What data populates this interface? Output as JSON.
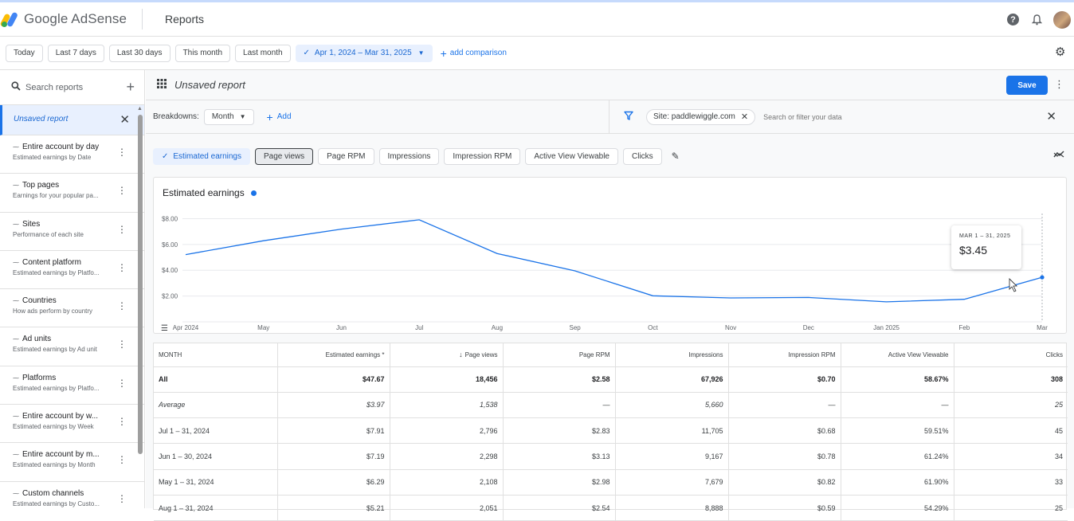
{
  "header": {
    "app_name": "Google AdSense",
    "page_title": "Reports",
    "help_glyph": "?",
    "bell_glyph": "🔔"
  },
  "date_filters": {
    "chips": [
      "Today",
      "Last 7 days",
      "Last 30 days",
      "This month",
      "Last month"
    ],
    "selected_range": "Apr 1, 2024 – Mar 31, 2025",
    "add_comparison": "add comparison"
  },
  "sidebar": {
    "search_placeholder": "Search reports",
    "selected": "Unsaved report",
    "items": [
      {
        "title": "Entire account by day",
        "sub": "Estimated earnings by Date"
      },
      {
        "title": "Top pages",
        "sub": "Earnings for your popular pa..."
      },
      {
        "title": "Sites",
        "sub": "Performance of each site"
      },
      {
        "title": "Content platform",
        "sub": "Estimated earnings by Platfo..."
      },
      {
        "title": "Countries",
        "sub": "How ads perform by country"
      },
      {
        "title": "Ad units",
        "sub": "Estimated earnings by Ad unit"
      },
      {
        "title": "Platforms",
        "sub": "Estimated earnings by Platfo..."
      },
      {
        "title": "Entire account by w...",
        "sub": "Estimated earnings by Week"
      },
      {
        "title": "Entire account by m...",
        "sub": "Estimated earnings by Month"
      },
      {
        "title": "Custom channels",
        "sub": "Estimated earnings by Custo..."
      }
    ]
  },
  "report": {
    "name": "Unsaved report",
    "save_label": "Save",
    "breakdowns_label": "Breakdowns:",
    "breakdown_value": "Month",
    "add_label": "Add",
    "site_filter": "Site: paddlewiggle.com",
    "filter_placeholder": "Search or filter your data"
  },
  "metrics": [
    "Estimated earnings",
    "Page views",
    "Page RPM",
    "Impressions",
    "Impression RPM",
    "Active View Viewable",
    "Clicks"
  ],
  "chart_data": {
    "type": "line",
    "title": "Estimated earnings",
    "x": [
      "Apr 2024",
      "May",
      "Jun",
      "Jul",
      "Aug",
      "Sep",
      "Oct",
      "Nov",
      "Dec",
      "Jan 2025",
      "Feb",
      "Mar"
    ],
    "values": [
      5.21,
      6.29,
      7.19,
      7.91,
      5.3,
      3.95,
      2.02,
      1.85,
      1.89,
      1.55,
      1.75,
      3.45
    ],
    "y_ticks": [
      2,
      4,
      6,
      8
    ],
    "y_tick_labels": [
      "$2.00",
      "$4.00",
      "$6.00",
      "$8.00"
    ],
    "ylim": [
      0,
      8.4
    ],
    "grid": true,
    "color": "#1a73e8",
    "tooltip": {
      "date": "MAR 1 – 31, 2025",
      "value": "$3.45"
    }
  },
  "table": {
    "headers": [
      "MONTH",
      "Estimated earnings *",
      "Page views",
      "Page RPM",
      "Impressions",
      "Impression RPM",
      "Active View Viewable",
      "Clicks"
    ],
    "total": [
      "All",
      "$47.67",
      "18,456",
      "$2.58",
      "67,926",
      "$0.70",
      "58.67%",
      "308"
    ],
    "average": [
      "Average",
      "$3.97",
      "1,538",
      "—",
      "5,660",
      "—",
      "—",
      "25"
    ],
    "rows": [
      [
        "Jul 1 – 31, 2024",
        "$7.91",
        "2,796",
        "$2.83",
        "11,705",
        "$0.68",
        "59.51%",
        "45"
      ],
      [
        "Jun 1 – 30, 2024",
        "$7.19",
        "2,298",
        "$3.13",
        "9,167",
        "$0.78",
        "61.24%",
        "34"
      ],
      [
        "May 1 – 31, 2024",
        "$6.29",
        "2,108",
        "$2.98",
        "7,679",
        "$0.82",
        "61.90%",
        "33"
      ],
      [
        "Aug 1 – 31, 2024",
        "$5.21",
        "2,051",
        "$2.54",
        "8,888",
        "$0.59",
        "54.29%",
        "25"
      ]
    ]
  }
}
